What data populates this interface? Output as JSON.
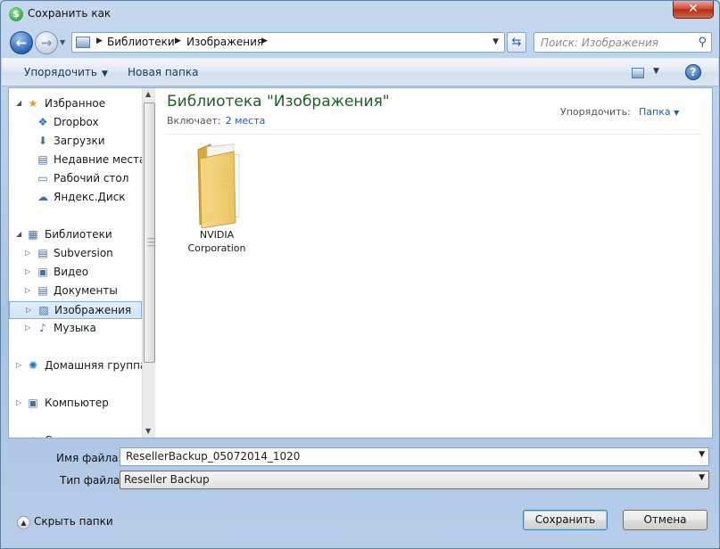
{
  "window": {
    "title": "Сохранить как",
    "close_glyph": "✕"
  },
  "address_bar": {
    "crumbs": [
      "Библиотеки",
      "Изображения"
    ],
    "search_placeholder": "Поиск: Изображения"
  },
  "toolbar": {
    "organize_label": "Упорядочить",
    "new_folder_label": "Новая папка",
    "help_glyph": "?"
  },
  "nav_pane": {
    "items": [
      {
        "label": "Избранное",
        "icon": "star-icon",
        "glyph": "★",
        "level": 0,
        "expanded": true
      },
      {
        "label": "Dropbox",
        "icon": "dropbox-icon",
        "glyph": "❖",
        "level": 1
      },
      {
        "label": "Загрузки",
        "icon": "downloads-folder-icon",
        "glyph": "⬇",
        "level": 1
      },
      {
        "label": "Недавние места",
        "icon": "recent-places-icon",
        "glyph": "▤",
        "level": 1
      },
      {
        "label": "Рабочий стол",
        "icon": "desktop-icon",
        "glyph": "▭",
        "level": 1
      },
      {
        "label": "Яндекс.Диск",
        "icon": "yandex-disk-icon",
        "glyph": "☁",
        "level": 1
      },
      {
        "label": "Библиотеки",
        "icon": "libraries-icon",
        "glyph": "▦",
        "level": 0,
        "expanded": true
      },
      {
        "label": "Subversion",
        "icon": "library-icon",
        "glyph": "▤",
        "level": 1
      },
      {
        "label": "Видео",
        "icon": "video-library-icon",
        "glyph": "▣",
        "level": 1
      },
      {
        "label": "Документы",
        "icon": "documents-library-icon",
        "glyph": "▤",
        "level": 1
      },
      {
        "label": "Изображения",
        "icon": "pictures-library-icon",
        "glyph": "▨",
        "level": 1,
        "selected": true
      },
      {
        "label": "Музыка",
        "icon": "music-library-icon",
        "glyph": "♪",
        "level": 1
      },
      {
        "label": "Домашняя группа",
        "icon": "homegroup-icon",
        "glyph": "✺",
        "level": 0
      },
      {
        "label": "Компьютер",
        "icon": "computer-icon",
        "glyph": "▣",
        "level": 0
      },
      {
        "label": "Сеть",
        "icon": "network-icon",
        "glyph": "✦",
        "level": 0
      }
    ]
  },
  "content": {
    "library_title": "Библиотека \"Изображения\"",
    "includes_label": "Включает:",
    "includes_link": "2 места",
    "arrange_label": "Упорядочить:",
    "arrange_value": "Папка",
    "items": [
      {
        "name": "NVIDIA Corporation",
        "type": "folder"
      }
    ]
  },
  "form": {
    "filename_label": "Имя файла:",
    "filename_value": "ResellerBackup_05072014_1020",
    "filetype_label": "Тип файла:",
    "filetype_value": "Reseller Backup"
  },
  "footer": {
    "hide_folders_label": "Скрыть папки",
    "save_label": "Сохранить",
    "cancel_label": "Отмена"
  }
}
